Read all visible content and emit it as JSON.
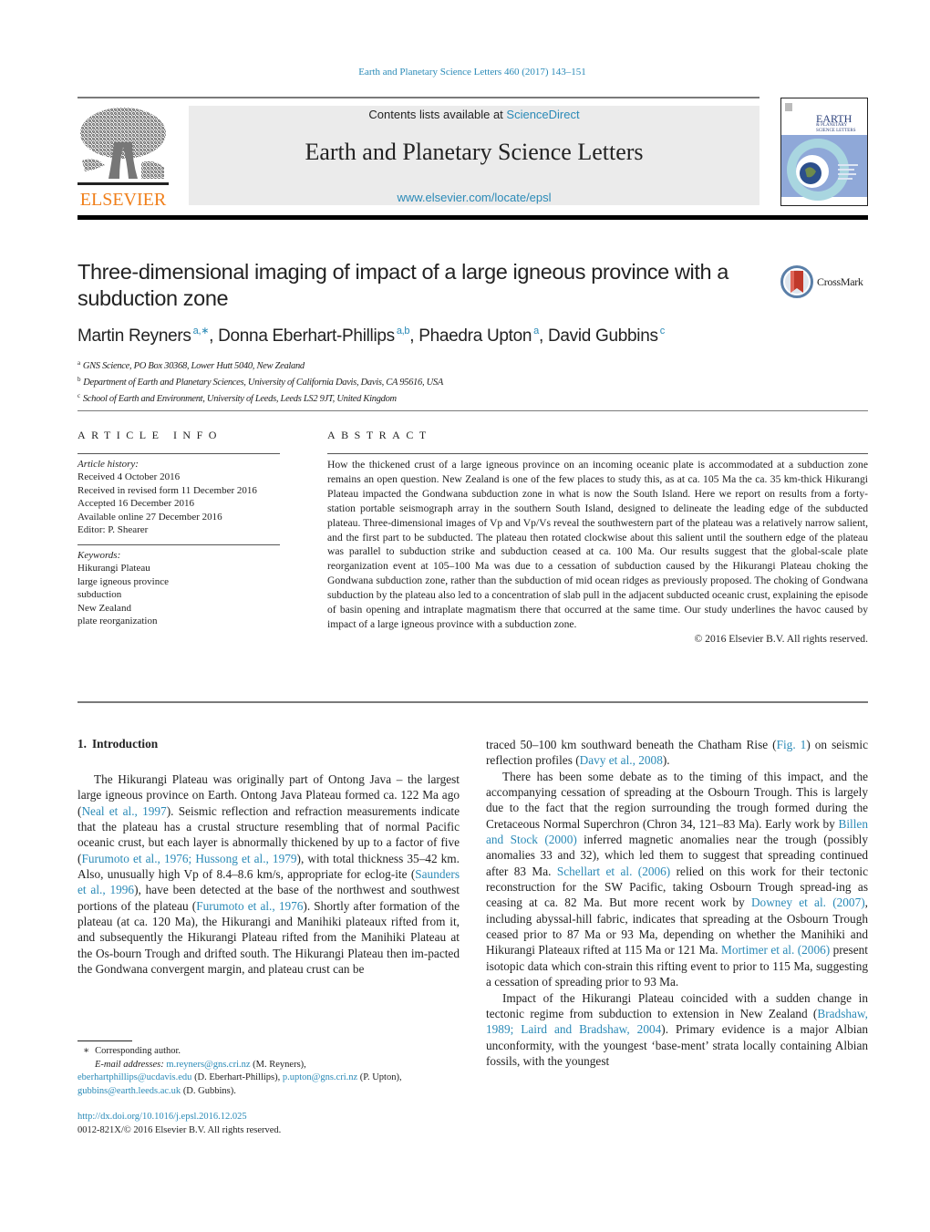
{
  "citation": "Earth and Planetary Science Letters 460 (2017) 143–151",
  "masthead": {
    "publisher_logo_text": "ELSEVIER",
    "contents_prefix": "Contents lists available at ",
    "contents_link": "ScienceDirect",
    "journal_title": "Earth and Planetary Science Letters",
    "journal_url": "www.elsevier.com/locate/epsl",
    "cover_title_lines": [
      "EARTH",
      "& PLANETARY",
      "SCIENCE LETTERS"
    ]
  },
  "paper": {
    "title": "Three-dimensional imaging of impact of a large igneous province with a subduction zone",
    "crossmark_label": "CrossMark",
    "authors": [
      {
        "name": "Martin Reyners",
        "sup": "a,∗"
      },
      {
        "name": "Donna Eberhart-Phillips",
        "sup": "a,b"
      },
      {
        "name": "Phaedra Upton",
        "sup": "a"
      },
      {
        "name": "David Gubbins",
        "sup": "c"
      }
    ],
    "affiliations": [
      {
        "key": "a",
        "text": "GNS Science, PO Box 30368, Lower Hutt 5040, New Zealand"
      },
      {
        "key": "b",
        "text": "Department of Earth and Planetary Sciences, University of California Davis, Davis, CA 95616, USA"
      },
      {
        "key": "c",
        "text": "School of Earth and Environment, University of Leeds, Leeds LS2 9JT, United Kingdom"
      }
    ]
  },
  "article_info": {
    "heading": "ARTICLE INFO",
    "history_label": "Article history:",
    "history": [
      "Received 4 October 2016",
      "Received in revised form 11 December 2016",
      "Accepted 16 December 2016",
      "Available online 27 December 2016",
      "Editor: P. Shearer"
    ],
    "keywords_label": "Keywords:",
    "keywords": [
      "Hikurangi Plateau",
      "large igneous province",
      "subduction",
      "New Zealand",
      "plate reorganization"
    ]
  },
  "abstract": {
    "heading": "ABSTRACT",
    "text": "How the thickened crust of a large igneous province on an incoming oceanic plate is accommodated at a subduction zone remains an open question. New Zealand is one of the few places to study this, as at ca. 105 Ma the ca. 35 km-thick Hikurangi Plateau impacted the Gondwana subduction zone in what is now the South Island. Here we report on results from a forty-station portable seismograph array in the southern South Island, designed to delineate the leading edge of the subducted plateau. Three-dimensional images of Vp and Vp/Vs reveal the southwestern part of the plateau was a relatively narrow salient, and the first part to be subducted. The plateau then rotated clockwise about this salient until the southern edge of the plateau was parallel to subduction strike and subduction ceased at ca. 100 Ma. Our results suggest that the global-scale plate reorganization event at 105–100 Ma was due to a cessation of subduction caused by the Hikurangi Plateau choking the Gondwana subduction zone, rather than the subduction of mid ocean ridges as previously proposed. The choking of Gondwana subduction by the plateau also led to a concentration of slab pull in the adjacent subducted oceanic crust, explaining the episode of basin opening and intraplate magmatism there that occurred at the same time. Our study underlines the havoc caused by impact of a large igneous province with a subduction zone.",
    "copyright": "© 2016 Elsevier B.V. All rights reserved."
  },
  "section": {
    "number": "1.",
    "title": "Introduction"
  },
  "body": {
    "left_para": [
      {
        "t": "The Hikurangi Plateau was originally part of Ontong Java – the largest large igneous province on Earth. Ontong Java Plateau formed ca. 122 Ma ago ("
      },
      {
        "l": "Neal et al., 1997"
      },
      {
        "t": "). Seismic reflection and refraction measurements indicate that the plateau has a crustal structure resembling that of normal Pacific oceanic crust, but each layer is abnormally thickened by up to a factor of five ("
      },
      {
        "l": "Furumoto et al., 1976; Hussong et al., 1979"
      },
      {
        "t": "), with total thickness 35–42 km. Also, unusually high Vp of 8.4–8.6 km/s, appropriate for eclog-ite ("
      },
      {
        "l": "Saunders et al., 1996"
      },
      {
        "t": "), have been detected at the base of the northwest and southwest portions of the plateau ("
      },
      {
        "l": "Furumoto et al., 1976"
      },
      {
        "t": "). Shortly after formation of the plateau (at ca. 120 Ma), the Hikurangi and Manihiki plateaux rifted from it, and subsequently the Hikurangi Plateau rifted from the Manihiki Plateau at the Os-bourn Trough and drifted south. The Hikurangi Plateau then im-pacted the Gondwana convergent margin, and plateau crust can be"
      }
    ],
    "right_para1": [
      {
        "t": "traced 50–100 km southward beneath the Chatham Rise ("
      },
      {
        "l": "Fig. 1"
      },
      {
        "t": ") on seismic reflection profiles ("
      },
      {
        "l": "Davy et al., 2008"
      },
      {
        "t": ")."
      }
    ],
    "right_para2": [
      {
        "t": "There has been some debate as to the timing of this impact, and the accompanying cessation of spreading at the Osbourn Trough. This is largely due to the fact that the region surrounding the trough formed during the Cretaceous Normal Superchron (Chron 34, 121–83 Ma). Early work by "
      },
      {
        "l": "Billen and Stock (2000)"
      },
      {
        "t": " inferred magnetic anomalies near the trough (possibly anomalies 33 and 32), which led them to suggest that spreading continued after 83 Ma. "
      },
      {
        "l": "Schellart et al. (2006)"
      },
      {
        "t": " relied on this work for their tectonic reconstruction for the SW Pacific, taking Osbourn Trough spread-ing as ceasing at ca. 82 Ma. But more recent work by "
      },
      {
        "l": "Downey et al. (2007)"
      },
      {
        "t": ", including abyssal-hill fabric, indicates that spreading at the Osbourn Trough ceased prior to 87 Ma or 93 Ma, depending on whether the Manihiki and Hikurangi Plateaux rifted at 115 Ma or 121 Ma. "
      },
      {
        "l": "Mortimer et al. (2006)"
      },
      {
        "t": " present isotopic data which con-strain this rifting event to prior to 115 Ma, suggesting a cessation of spreading prior to 93 Ma."
      }
    ],
    "right_para3": [
      {
        "t": "Impact of the Hikurangi Plateau coincided with a sudden change in tectonic regime from subduction to extension in New Zealand ("
      },
      {
        "l": "Bradshaw, 1989; Laird and Bradshaw, 2004"
      },
      {
        "t": "). Primary evidence is a major Albian unconformity, with the youngest ‘base-ment’ strata locally containing Albian fossils, with the youngest"
      }
    ]
  },
  "footnotes": {
    "star": "∗",
    "corresponding": "Corresponding author.",
    "email_label": "E-mail addresses:",
    "emails": [
      {
        "addr": "m.reyners@gns.cri.nz",
        "who": "(M. Reyners),"
      },
      {
        "addr": "eberhartphillips@ucdavis.edu",
        "who": "(D. Eberhart-Phillips),"
      },
      {
        "addr": "p.upton@gns.cri.nz",
        "who": "(P. Upton),"
      },
      {
        "addr": "gubbins@earth.leeds.ac.uk",
        "who": "(D. Gubbins)."
      }
    ],
    "doi": "http://dx.doi.org/10.1016/j.epsl.2016.12.025",
    "issn_line": "0012-821X/© 2016 Elsevier B.V. All rights reserved."
  },
  "colors": {
    "link": "#2a8ab7",
    "elsevier_orange": "#f07f1a",
    "masthead_bg": "#ebebeb"
  }
}
